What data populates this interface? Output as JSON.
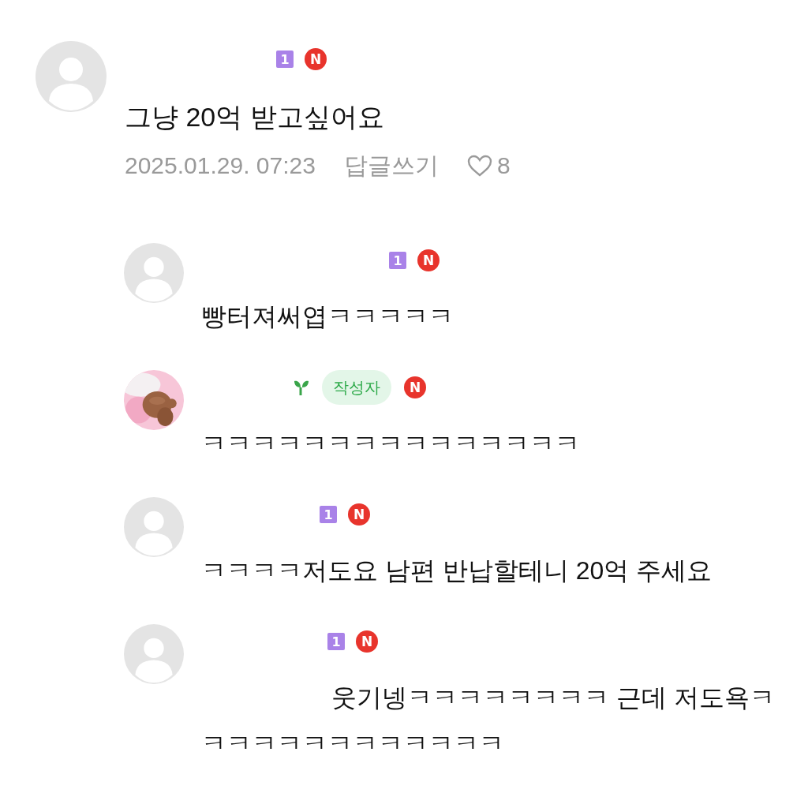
{
  "comments": [
    {
      "avatar": {
        "kind": "default"
      },
      "badges": [
        {
          "kind": "level",
          "text": "1"
        },
        {
          "kind": "new",
          "text": "N"
        }
      ],
      "text": "그냥 20억 받고싶어요",
      "date": "2025.01.29. 07:23",
      "reply_link": "답글쓰기",
      "likes": "8",
      "replies": [
        {
          "avatar": {
            "kind": "default"
          },
          "badges": [
            {
              "kind": "level",
              "text": "1"
            },
            {
              "kind": "new",
              "text": "N"
            }
          ],
          "text": "빵터져써엽ㅋㅋㅋㅋㅋ"
        },
        {
          "avatar": {
            "kind": "picture"
          },
          "badges": [
            {
              "kind": "sprout"
            },
            {
              "kind": "author",
              "text": "작성자"
            },
            {
              "kind": "new",
              "text": "N"
            }
          ],
          "text": "ㅋㅋㅋㅋㅋㅋㅋㅋㅋㅋㅋㅋㅋㅋㅋ"
        },
        {
          "avatar": {
            "kind": "default"
          },
          "badges": [
            {
              "kind": "level",
              "text": "1"
            },
            {
              "kind": "new",
              "text": "N"
            }
          ],
          "text": "ㅋㅋㅋㅋ저도요 남편 반납할테니 20억 주세요"
        },
        {
          "avatar": {
            "kind": "default"
          },
          "badges": [
            {
              "kind": "level",
              "text": "1"
            },
            {
              "kind": "new",
              "text": "N"
            }
          ],
          "text": "웃기넹ㅋㅋㅋㅋㅋㅋㅋㅋ 근데 저도욕ㅋㅋㅋㅋㅋㅋㅋㅋㅋㅋㅋㅋㅋ"
        }
      ]
    }
  ]
}
